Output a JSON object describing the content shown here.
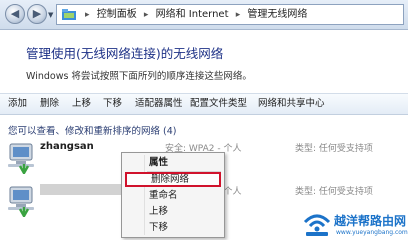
{
  "address_bar": {
    "breadcrumbs": [
      "控制面板",
      "网络和 Internet",
      "管理无线网络"
    ]
  },
  "page": {
    "title": "管理使用(无线网络连接)的无线网络",
    "description": "Windows 将尝试按照下面所列的顺序连接这些网络。"
  },
  "toolbar": {
    "items": [
      "添加",
      "删除",
      "上移",
      "下移",
      "适配器属性",
      "配置文件类型",
      "网络和共享中心"
    ]
  },
  "networks": {
    "header": "您可以查看、修改和重新排序的网络 (4)",
    "items": [
      {
        "name": "zhangsan",
        "security": "安全: WPA2 - 个人",
        "type": "类型: 任何受支持项"
      },
      {
        "name": "",
        "security": "安全: WPA2 - 个人",
        "type": "类型: 任何受支持项"
      }
    ]
  },
  "context_menu": {
    "items": [
      "属性",
      "删除网络",
      "重命名",
      "上移",
      "下移"
    ],
    "highlighted_index": 1,
    "highlight_color": "#d0112b"
  },
  "watermark": {
    "name": "越洋帮路由网",
    "url": "www.yueyangbang.com",
    "color": "#1c73c9"
  },
  "colors": {
    "title": "#1e3287",
    "section_header": "#2a3d72",
    "muted_text": "#8a8a8a"
  }
}
